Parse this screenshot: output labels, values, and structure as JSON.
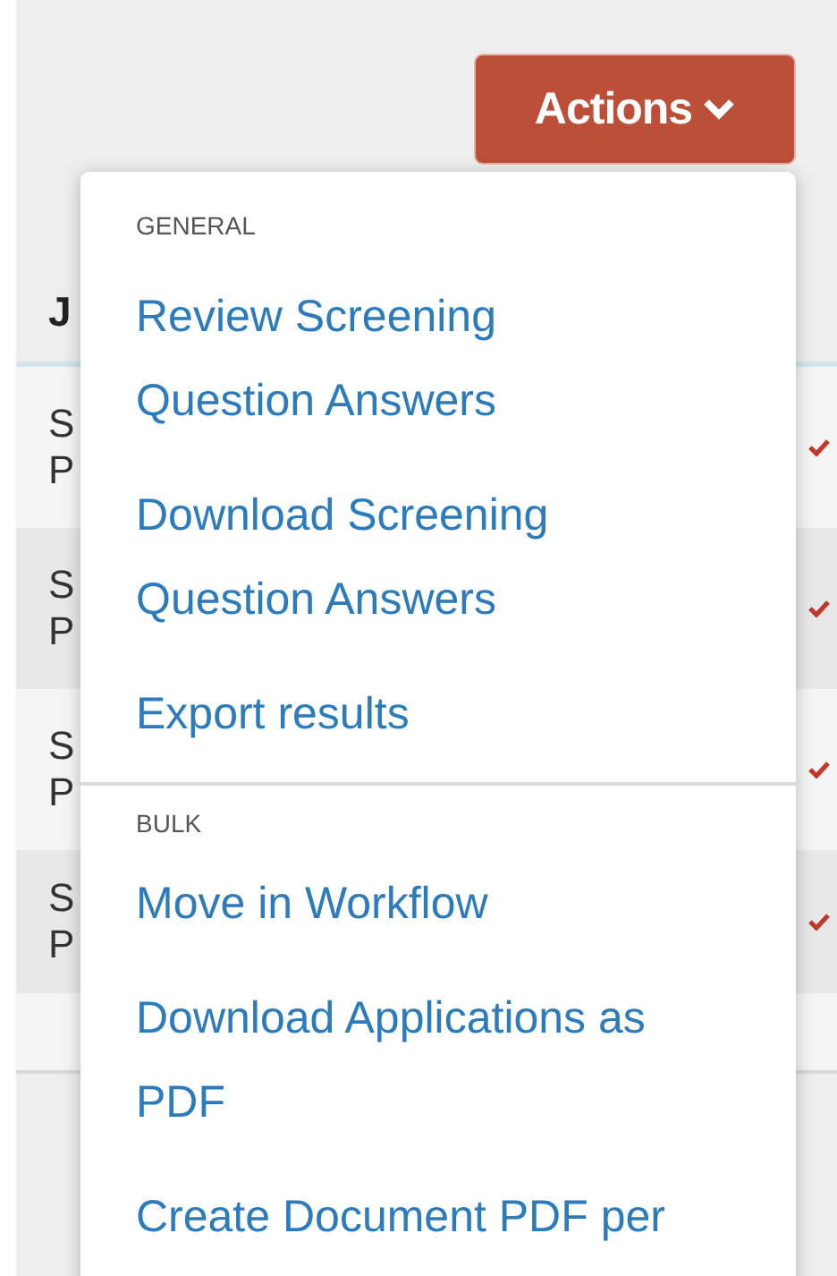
{
  "actions_button": {
    "label": "Actions"
  },
  "table": {
    "header": "J",
    "rows": [
      {
        "line_1": "S",
        "line_2": "P",
        "checked": true
      },
      {
        "line_1": "S",
        "line_2": "P",
        "checked": true
      },
      {
        "line_1": "S",
        "line_2": "P",
        "checked": true
      },
      {
        "line_1": "S",
        "line_2": "P",
        "checked": true
      }
    ]
  },
  "menu": {
    "sections": [
      {
        "heading": "GENERAL",
        "items": [
          "Review Screening Question Answers",
          "Download Screening Question Answers",
          "Export results"
        ]
      },
      {
        "heading": "BULK",
        "items": [
          "Move in Workflow",
          "Download Applications as PDF",
          "Create Document PDF per"
        ]
      }
    ]
  }
}
